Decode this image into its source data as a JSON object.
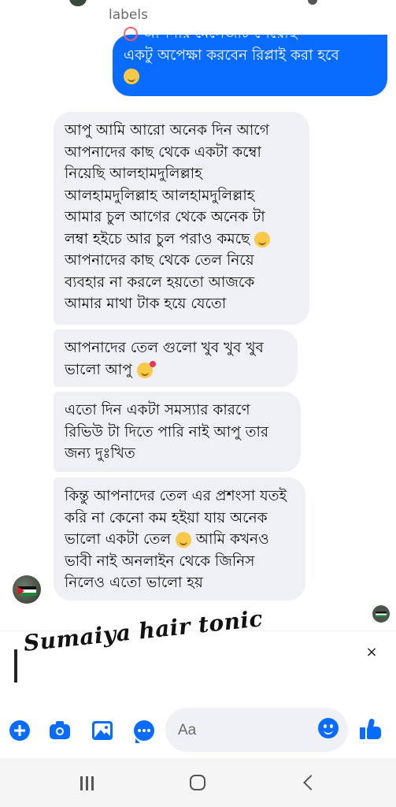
{
  "header": {
    "previous_label": "labels"
  },
  "outgoing_message": {
    "cut_off_text": "আপনার মেসেজটি পেয়েছি",
    "text": "একটু অপেক্ষা করবেন রিপ্লাই করা হবে",
    "emoji": "hugging-face"
  },
  "incoming_messages": [
    {
      "lines": [
        "আপু আমি আরো অনেক দিন আগে",
        "আপনাদের কাছ থেকে একটা কম্বো",
        "নিয়েছি আলহামদুলিল্লাহ",
        "আলহামদুলিল্লাহ আলহামদুলিল্লাহ",
        "আমার চুল আগের থেকে অনেক টা",
        "লম্বা হইচে আর চুল পরাও কমছে",
        "আপনাদের কাছ থেকে তেল নিয়ে",
        "ব্যবহার না করলে হয়তো আজকে",
        "আমার মাথা টাক হয়ে যেতো"
      ]
    },
    {
      "lines": [
        "আপনাদের তেল গুলো খুব খুব খুব",
        "ভালো আপু"
      ]
    },
    {
      "lines": [
        "এতো দিন একটা সমস্যার কারণে",
        "রিভিউ টা দিতে পারি নাই আপু তার",
        "জন্য দুঃখিত"
      ]
    },
    {
      "lines": [
        "কিন্তু আপনাদের তেল এর প্রশংসা যতই",
        "করি না কেনো কম হইয়া যায় অনেক",
        "ভালো একটা তেল",
        "আমি কখনও",
        "ভাবী নাই অনলাইন থেকে জিনিস",
        "নিলেও এতো ভালো হয়"
      ]
    }
  ],
  "watermark": {
    "text": "Sumaiya hair tonic"
  },
  "composer": {
    "placeholder": "Aa",
    "close_symbol": "×"
  },
  "icons": {
    "add": "plus-icon",
    "camera": "camera-icon",
    "gallery": "photo-icon",
    "more": "chat-dots-icon",
    "emoji": "smiley-icon",
    "like": "thumbs-up-icon"
  },
  "colors": {
    "accent": "#0a6cff",
    "incoming_bubble": "#eff0f4"
  }
}
